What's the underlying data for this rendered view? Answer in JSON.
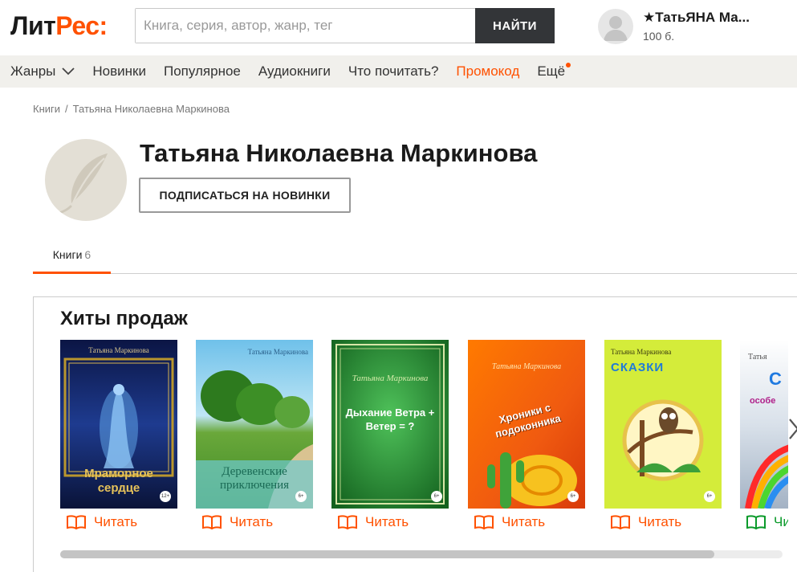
{
  "logo": {
    "part1": "Лит",
    "part2": "Рес:"
  },
  "search": {
    "placeholder": "Книга, серия, автор, жанр, тег",
    "button": "НАЙТИ"
  },
  "user": {
    "name": "★ТатьЯНА Ма...",
    "points": "100 б."
  },
  "nav": {
    "items": [
      "Жанры",
      "Новинки",
      "Популярное",
      "Аудиокниги",
      "Что почитать?",
      "Промокод",
      "Ещё"
    ]
  },
  "breadcrumb": {
    "root": "Книги",
    "separator": "/",
    "current": "Татьяна Николаевна Маркинова"
  },
  "author": {
    "name": "Татьяна Николаевна Маркинова",
    "subscribe": "ПОДПИСАТЬСЯ НА НОВИНКИ"
  },
  "tabs": [
    {
      "label": "Книги",
      "count": "6"
    }
  ],
  "hits": {
    "title": "Хиты продаж",
    "read_label": "Читать",
    "books": [
      {
        "author": "Татьяна Маркинова",
        "title": "Мраморное сердце",
        "age": "12+",
        "colors": [
          "#0c1a4a",
          "#1f3a8a"
        ]
      },
      {
        "author": "Татьяна Маркинова",
        "title": "Деревенские приключения",
        "age": "6+",
        "colors": [
          "#8fd0ee",
          "#4a9a2a"
        ]
      },
      {
        "author": "Татьяна Маркинова",
        "title": "Дыхание Ветра + Ветер = ?",
        "age": "6+",
        "colors": [
          "#2f9a3a",
          "#1b6b25"
        ]
      },
      {
        "author": "Татьяна Маркинова",
        "title": "Хроники с подоконника",
        "age": "6+",
        "colors": [
          "#ff6a00",
          "#e84a10"
        ]
      },
      {
        "author": "Татьяна Маркинова",
        "title": "СКАЗКИ",
        "age": "6+",
        "colors": [
          "#d8ee3a",
          "#b6d81c"
        ]
      },
      {
        "author": "Татья",
        "title": "С",
        "subtitle": "особе",
        "age": "",
        "colors": [
          "#ffffff",
          "#a7b6c8"
        ]
      }
    ]
  },
  "accent": "#ff5100"
}
